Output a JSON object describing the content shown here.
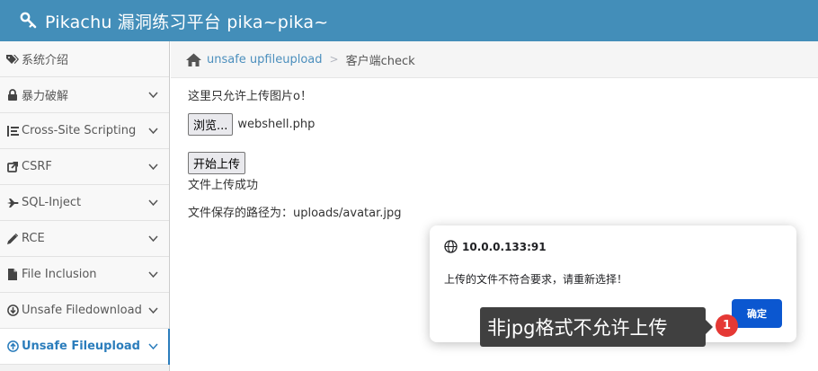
{
  "header": {
    "title": "Pikachu 漏洞练习平台 pika~pika~",
    "logo_icon": "key-icon",
    "color": "#438eb9"
  },
  "sidebar": {
    "items": [
      {
        "label": "系统介绍",
        "icon": "tags-icon",
        "has_chevron": false
      },
      {
        "label": "暴力破解",
        "icon": "lock-icon",
        "has_chevron": true
      },
      {
        "label": "Cross-Site Scripting",
        "icon": "list-tree-icon",
        "has_chevron": true
      },
      {
        "label": "CSRF",
        "icon": "external-link-icon",
        "has_chevron": true
      },
      {
        "label": "SQL-Inject",
        "icon": "plane-icon",
        "has_chevron": true
      },
      {
        "label": "RCE",
        "icon": "pencil-icon",
        "has_chevron": true
      },
      {
        "label": "File Inclusion",
        "icon": "file-icon",
        "has_chevron": true
      },
      {
        "label": "Unsafe Filedownload",
        "icon": "download-circle-icon",
        "has_chevron": true
      },
      {
        "label": "Unsafe Fileupload",
        "icon": "upload-circle-icon",
        "has_chevron": true,
        "active": true
      }
    ],
    "active_color": "#2b7dbc"
  },
  "breadcrumb": {
    "home_icon": "home-icon",
    "link": "unsafe upfileupload",
    "separator": ">",
    "current": "客户端check"
  },
  "content": {
    "hint": "这里只允许上传图片o！",
    "browse_button": "浏览...",
    "file_name": "webshell.php",
    "upload_button": "开始上传",
    "result": "文件上传成功",
    "saved_path": "文件保存的路径为：uploads/avatar.jpg"
  },
  "dialog": {
    "origin_icon": "globe-icon",
    "origin": "10.0.0.133:91",
    "message": "上传的文件不符合要求，请重新选择！",
    "ok_button": "确定",
    "ok_color": "#0b57d0"
  },
  "annotation": {
    "text": "非jpg格式不允许上传",
    "badge": "1",
    "badge_color": "#e53935"
  }
}
